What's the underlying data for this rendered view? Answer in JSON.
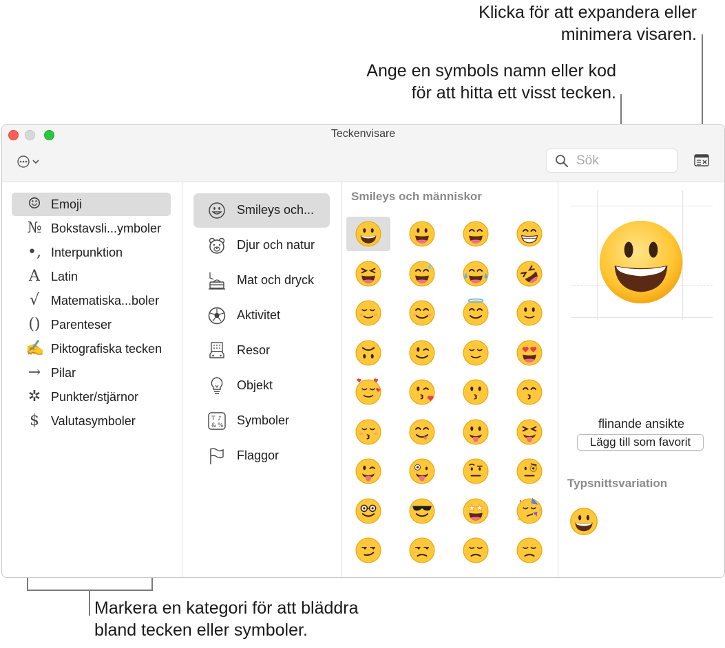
{
  "callouts": {
    "expand": {
      "line1": "Klicka för att expandera eller",
      "line2": "minimera visaren."
    },
    "search": {
      "line1": "Ange en symbols namn eller kod",
      "line2": "för att hitta ett visst tecken."
    },
    "category": {
      "line1": "Markera en kategori för att bläddra",
      "line2": "bland tecken eller symboler."
    }
  },
  "window": {
    "title": "Teckenvisare",
    "search_placeholder": "Sök"
  },
  "categories": [
    {
      "icon": "smiley-outline-icon",
      "glyph": "☺",
      "label": "Emoji",
      "selected": true
    },
    {
      "icon": "numero-sign-icon",
      "glyph": "№",
      "label": "Bokstavsli...ymboler",
      "selected": false
    },
    {
      "icon": "punctuation-icon",
      "glyph": "•,",
      "label": "Interpunktion",
      "selected": false
    },
    {
      "icon": "latin-letter-icon",
      "glyph": "A",
      "label": "Latin",
      "selected": false
    },
    {
      "icon": "square-root-icon",
      "glyph": "√",
      "label": "Matematiska...boler",
      "selected": false
    },
    {
      "icon": "parentheses-icon",
      "glyph": "()",
      "label": "Parenteser",
      "selected": false
    },
    {
      "icon": "pen-hand-icon",
      "glyph": "✍",
      "label": "Piktografiska tecken",
      "selected": false
    },
    {
      "icon": "right-arrow-icon",
      "glyph": "→",
      "label": "Pilar",
      "selected": false
    },
    {
      "icon": "asterisk-star-icon",
      "glyph": "✲",
      "label": "Punkter/stjärnor",
      "selected": false
    },
    {
      "icon": "dollar-sign-icon",
      "glyph": "$",
      "label": "Valutasymboler",
      "selected": false
    }
  ],
  "subcategories": [
    {
      "icon": "smiley-face-icon",
      "label": "Smileys och...",
      "selected": true
    },
    {
      "icon": "bear-face-icon",
      "label": "Djur och natur",
      "selected": false
    },
    {
      "icon": "cup-and-cake-icon",
      "label": "Mat och dryck",
      "selected": false
    },
    {
      "icon": "soccer-ball-icon",
      "label": "Aktivitet",
      "selected": false
    },
    {
      "icon": "building-car-icon",
      "label": "Resor",
      "selected": false
    },
    {
      "icon": "light-bulb-icon",
      "label": "Objekt",
      "selected": false
    },
    {
      "icon": "symbols-icon",
      "label": "Symboler",
      "selected": false
    },
    {
      "icon": "flag-icon",
      "label": "Flaggor",
      "selected": false
    }
  ],
  "emoji_section_title": "Smileys och människor",
  "emoji_grid": [
    "grinning-face",
    "grinning-face-big-eyes",
    "grinning-face-smiling-eyes",
    "beaming-face",
    "grinning-squinting-face",
    "grinning-face-sweat",
    "face-tears-of-joy",
    "rolling-laughing-face",
    "smiling-face",
    "smiling-face-smiling-eyes",
    "smiling-face-halo",
    "slightly-smiling-face",
    "upside-down-face",
    "winking-face",
    "relieved-face",
    "smiling-face-heart-eyes",
    "smiling-face-hearts",
    "face-blowing-kiss",
    "kissing-face",
    "kissing-face-smiling-eyes",
    "kissing-face-closed-eyes",
    "face-savoring-food",
    "face-with-tongue",
    "squinting-face-tongue",
    "winking-face-tongue",
    "zany-face",
    "face-raised-eyebrow",
    "face-with-monocle",
    "nerd-face",
    "smiling-face-sunglasses",
    "star-struck",
    "partying-face",
    "smirking-face",
    "unamused-face",
    "disappointed-face",
    "pensive-face"
  ],
  "detail": {
    "preview_icon": "grinning-face-large",
    "character_name": "flinande ansikte",
    "favorite_button": "Lägg till som favorit",
    "variation_title": "Typsnittsvariation",
    "variation_icon": "grinning-face-variation"
  },
  "colors": {
    "emoji_yellow": "#ffcb3d",
    "selection_gray": "#dcdcdc",
    "close": "#fe5f57",
    "maximize": "#28c840",
    "section_title_gray": "#8a8a8a"
  }
}
